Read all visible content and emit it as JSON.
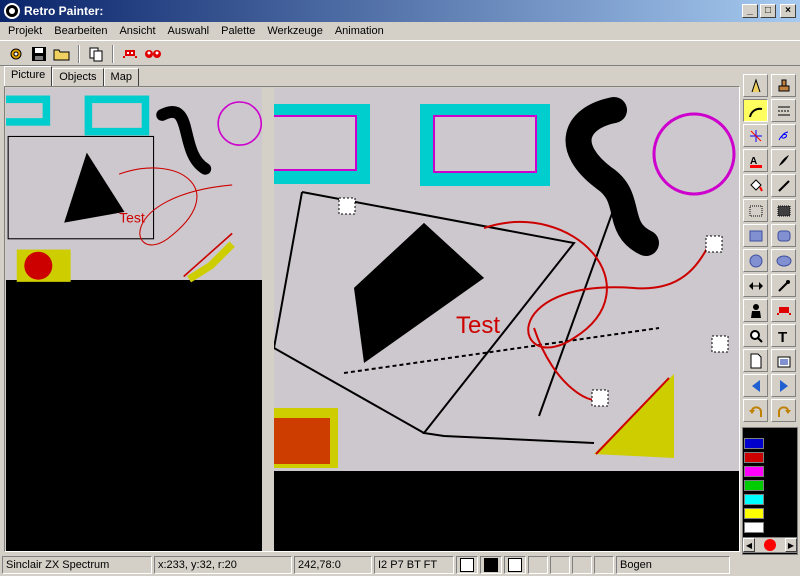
{
  "window": {
    "title": "Retro Painter:",
    "controls": [
      "_",
      "□",
      "×"
    ]
  },
  "menu": [
    "Projekt",
    "Bearbeiten",
    "Ansicht",
    "Auswahl",
    "Palette",
    "Werkzeuge",
    "Animation"
  ],
  "toolbar": {
    "icons": [
      "settings-icon",
      "save-icon",
      "open-folder-icon",
      "copy-icon",
      "sprite-red-icon",
      "sprite-pair-icon"
    ]
  },
  "tabs": [
    {
      "label": "Picture",
      "active": true
    },
    {
      "label": "Objects",
      "active": false
    },
    {
      "label": "Map",
      "active": false
    }
  ],
  "canvas": {
    "text_label": "Test",
    "colors": {
      "background": "#cdc8cd",
      "cyan": "#00cdcd",
      "magenta": "#cd00cd",
      "red": "#cd0000",
      "yellow": "#cdcd00",
      "black": "#000000"
    }
  },
  "tools": [
    {
      "name": "pen-tool-icon",
      "active": false
    },
    {
      "name": "stamp-tool-icon",
      "active": false
    },
    {
      "name": "arc-tool-icon",
      "active": true
    },
    {
      "name": "lines-tool-icon",
      "active": false
    },
    {
      "name": "star-lines-tool-icon",
      "active": false
    },
    {
      "name": "spiral-tool-icon",
      "active": false
    },
    {
      "name": "text-color-tool-icon",
      "active": false
    },
    {
      "name": "brush-tool-icon",
      "active": false
    },
    {
      "name": "fill-tool-icon",
      "active": false
    },
    {
      "name": "pipette-tool-icon",
      "active": false
    },
    {
      "name": "select-rect-tool-icon",
      "active": false
    },
    {
      "name": "select-dots-tool-icon",
      "active": false
    },
    {
      "name": "rect-tool-icon",
      "active": false
    },
    {
      "name": "rounded-rect-tool-icon",
      "active": false
    },
    {
      "name": "circle-tool-icon",
      "active": false
    },
    {
      "name": "ellipse-tool-icon",
      "active": false
    },
    {
      "name": "mirror-tool-icon",
      "active": false
    },
    {
      "name": "eyedropper-tool-icon",
      "active": false
    },
    {
      "name": "person-tool-icon",
      "active": false
    },
    {
      "name": "invader-tool-icon",
      "active": false
    },
    {
      "name": "zoom-tool-icon",
      "active": false
    },
    {
      "name": "text-tool-icon",
      "active": false
    },
    {
      "name": "new-page-tool-icon",
      "active": false
    },
    {
      "name": "picture-tool-icon",
      "active": false
    },
    {
      "name": "arrow-left-tool-icon",
      "active": false
    },
    {
      "name": "arrow-right-tool-icon",
      "active": false
    },
    {
      "name": "undo-tool-icon",
      "active": false
    },
    {
      "name": "redo-tool-icon",
      "active": false
    }
  ],
  "palette": {
    "colors": [
      "#0000cd",
      "#cd0000",
      "#ff00ff",
      "#00cd00",
      "#00ffff",
      "#ffff00",
      "#ffffff"
    ],
    "indicator_color": "#ff0000"
  },
  "status": {
    "system": "Sinclair ZX Spectrum",
    "coords": "x:233, y:32, r:20",
    "pos": "242,78:0",
    "attrs": "I2 P7 BT FT",
    "tool": "Bogen"
  }
}
